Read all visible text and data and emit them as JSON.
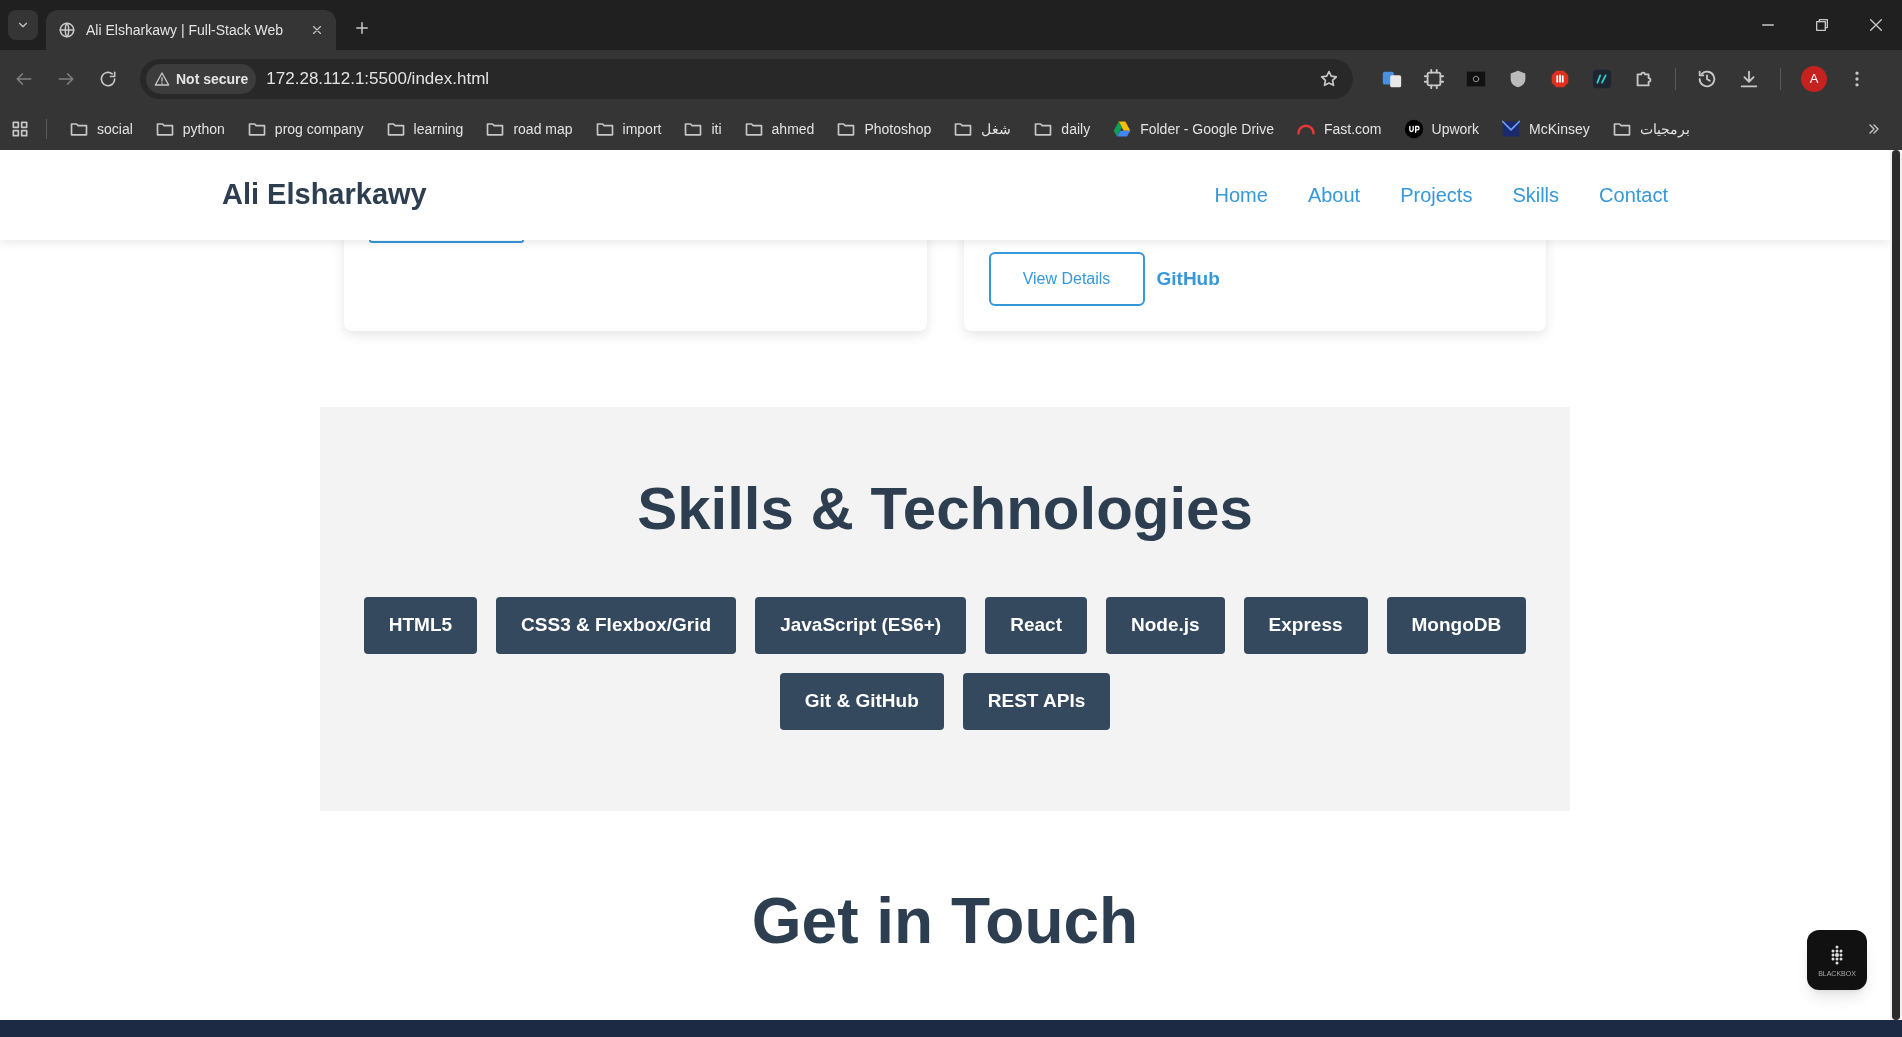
{
  "browser": {
    "tab": {
      "title": "Ali Elsharkawy | Full-Stack Web"
    },
    "address": {
      "security": "Not secure",
      "url": "172.28.112.1:5500/index.html"
    },
    "profile": "A",
    "bookmarks": [
      {
        "label": "social",
        "kind": "folder"
      },
      {
        "label": "python",
        "kind": "folder"
      },
      {
        "label": "prog company",
        "kind": "folder"
      },
      {
        "label": "learning",
        "kind": "folder"
      },
      {
        "label": "road map",
        "kind": "folder"
      },
      {
        "label": "import",
        "kind": "folder"
      },
      {
        "label": "iti",
        "kind": "folder"
      },
      {
        "label": "ahmed",
        "kind": "folder"
      },
      {
        "label": "Photoshop",
        "kind": "folder"
      },
      {
        "label": "شغل",
        "kind": "folder"
      },
      {
        "label": "daily",
        "kind": "folder"
      },
      {
        "label": "Folder - Google Drive",
        "kind": "drive"
      },
      {
        "label": "Fast.com",
        "kind": "gauge"
      },
      {
        "label": "Upwork",
        "kind": "up"
      },
      {
        "label": "McKinsey",
        "kind": "mck"
      },
      {
        "label": "برمجيات",
        "kind": "folder"
      }
    ]
  },
  "page": {
    "header": {
      "logo": "Ali Elsharkawy",
      "nav": [
        "Home",
        "About",
        "Projects",
        "Skills",
        "Contact"
      ]
    },
    "project_cards": [
      {
        "button_edge_visible": true
      },
      {
        "button_edge_visible": false,
        "buttons": [
          {
            "label": "View Details",
            "kind": "outline"
          },
          {
            "label": "GitHub",
            "kind": "link"
          }
        ]
      }
    ],
    "skills": {
      "title": "Skills & Technologies",
      "tags": [
        "HTML5",
        "CSS3 & Flexbox/Grid",
        "JavaScript (ES6+)",
        "React",
        "Node.js",
        "Express",
        "MongoDB",
        "Git & GitHub",
        "REST APIs"
      ]
    },
    "contact": {
      "title": "Get in Touch"
    },
    "assistant_button": {
      "label": "BLACKBOX"
    }
  }
}
